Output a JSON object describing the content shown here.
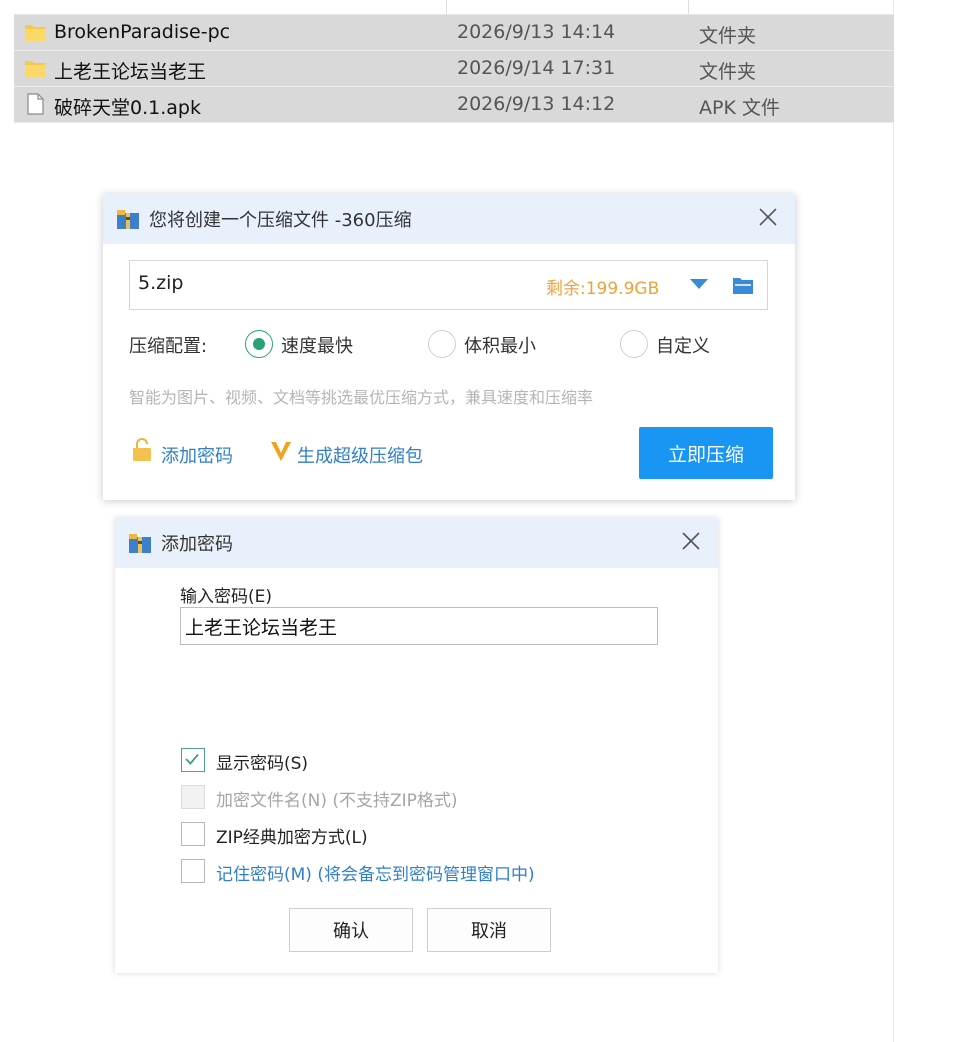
{
  "file_list": {
    "rows": [
      {
        "name": "BrokenParadise-pc",
        "date": "2026/9/13 14:14",
        "type": "文件夹",
        "icon": "folder-icon"
      },
      {
        "name": "上老王论坛当老王",
        "date": "2026/9/14 17:31",
        "type": "文件夹",
        "icon": "folder-icon"
      },
      {
        "name": "破碎天堂0.1.apk",
        "date": "2026/9/13 14:12",
        "type": "APK 文件",
        "icon": "file-icon"
      }
    ]
  },
  "compress_dialog": {
    "title": "您将创建一个压缩文件 -360压缩",
    "filename": "5.zip",
    "free_space": "剩余:199.9GB",
    "config_label": "压缩配置:",
    "options": [
      {
        "label": "速度最快",
        "selected": true
      },
      {
        "label": "体积最小",
        "selected": false
      },
      {
        "label": "自定义",
        "selected": false
      }
    ],
    "hint": "智能为图片、视频、文档等挑选最优压缩方式，兼具速度和压缩率",
    "add_password": "添加密码",
    "super_package": "生成超级压缩包",
    "compress_button": "立即压缩"
  },
  "password_dialog": {
    "title": "添加密码",
    "input_label": "输入密码(E)",
    "password_value": "上老王论坛当老王",
    "checkboxes": [
      {
        "label": "显示密码(S)",
        "checked": true,
        "disabled": false
      },
      {
        "label": "加密文件名(N) (不支持ZIP格式)",
        "checked": false,
        "disabled": true
      },
      {
        "label": "ZIP经典加密方式(L)",
        "checked": false,
        "disabled": false
      },
      {
        "label": "记住密码(M) (将会备忘到密码管理窗口中)",
        "checked": false,
        "disabled": false
      }
    ],
    "ok_button": "确认",
    "cancel_button": "取消"
  },
  "colors": {
    "accent": "#1996f3",
    "link": "#2f7fc9",
    "free_space": "#f0a23a",
    "radio_on": "#2aa079",
    "title_bar": "#e8f1fb",
    "selection": "#d9d9d9"
  }
}
